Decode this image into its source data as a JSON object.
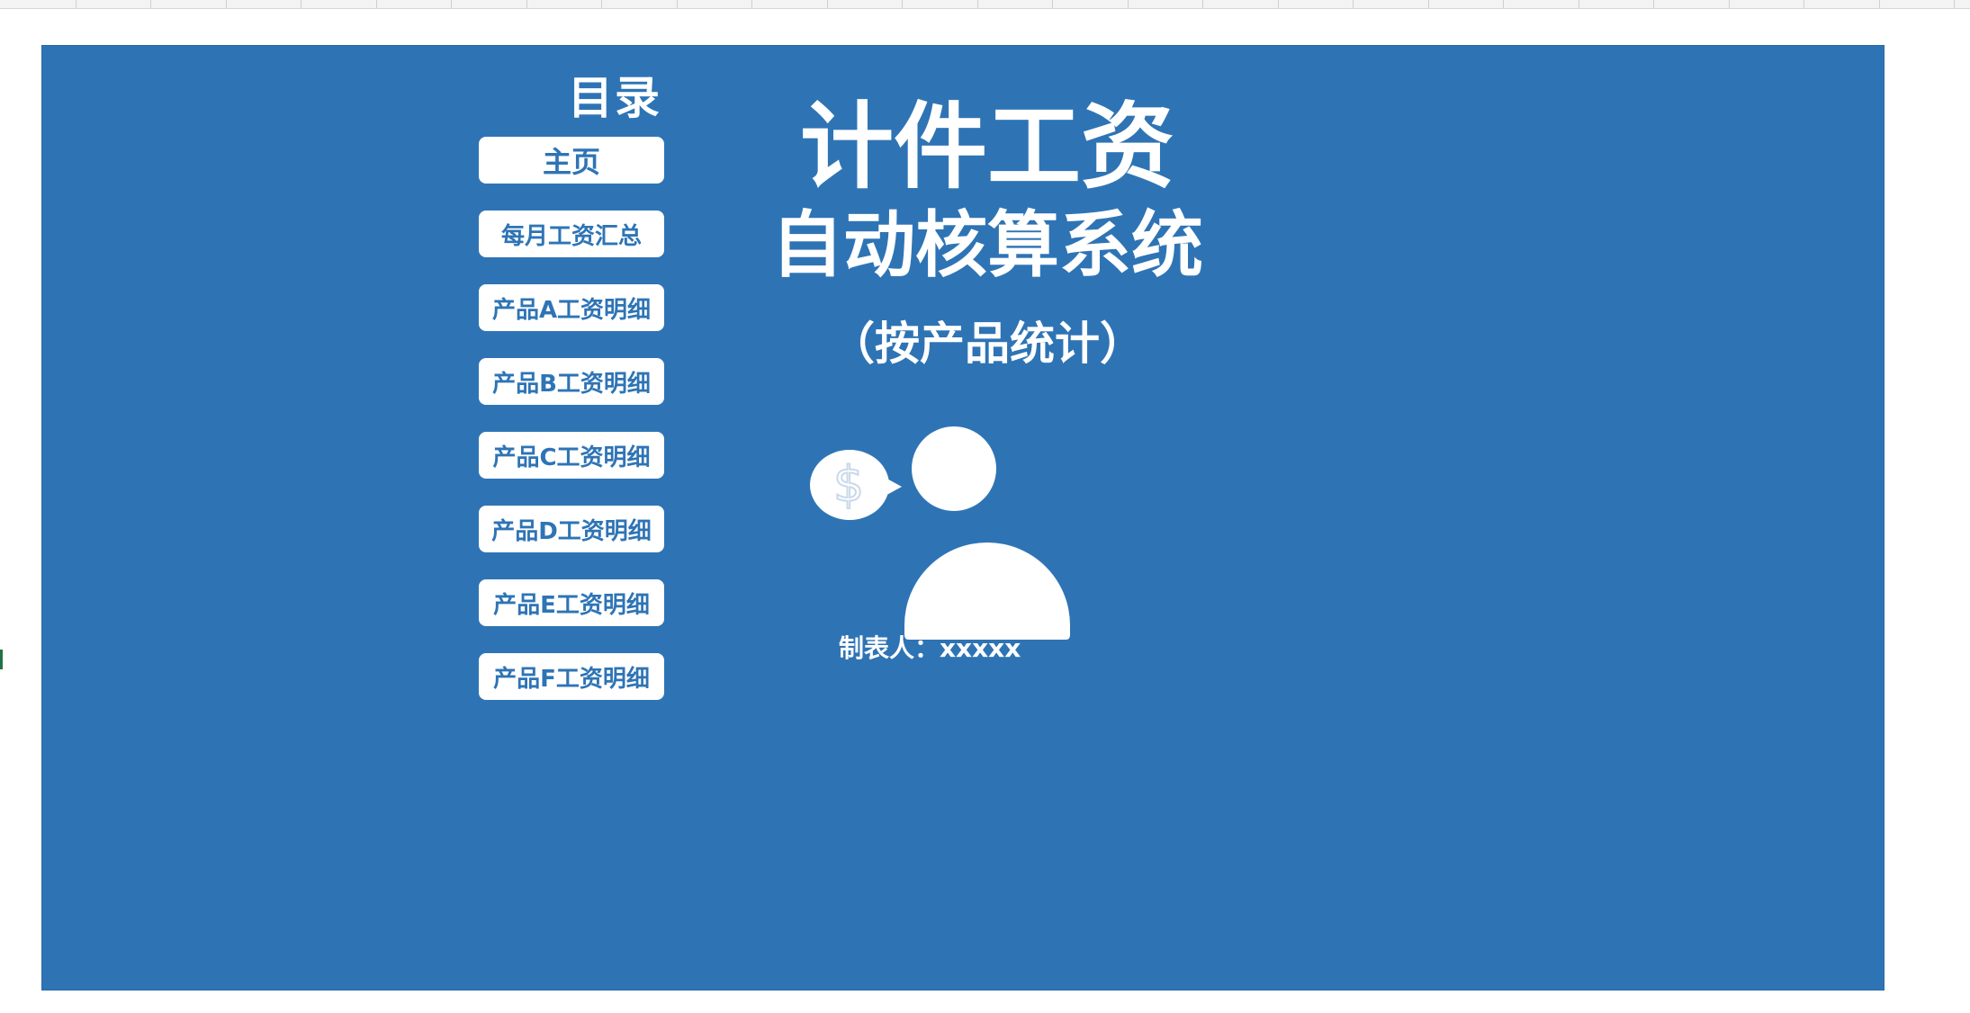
{
  "menu": {
    "title": "目录",
    "items": [
      {
        "label": "主页"
      },
      {
        "label": "每月工资汇总"
      },
      {
        "label": "产品A工资明细"
      },
      {
        "label": "产品B工资明细"
      },
      {
        "label": "产品C工资明细"
      },
      {
        "label": "产品D工资明细"
      },
      {
        "label": "产品E工资明细"
      },
      {
        "label": "产品F工资明细"
      }
    ]
  },
  "title": {
    "line1": "计件工资",
    "line2": "自动核算系统",
    "note": "（按产品统计）"
  },
  "graphic": {
    "icon": "person-with-dollar-speech-bubble-icon",
    "symbol": "$"
  },
  "maker": {
    "label": "制表人：xxxxx"
  },
  "colors": {
    "background": "#2e74b5",
    "button": "#ffffff",
    "button_text": "#2e74b5",
    "text": "#ffffff"
  }
}
